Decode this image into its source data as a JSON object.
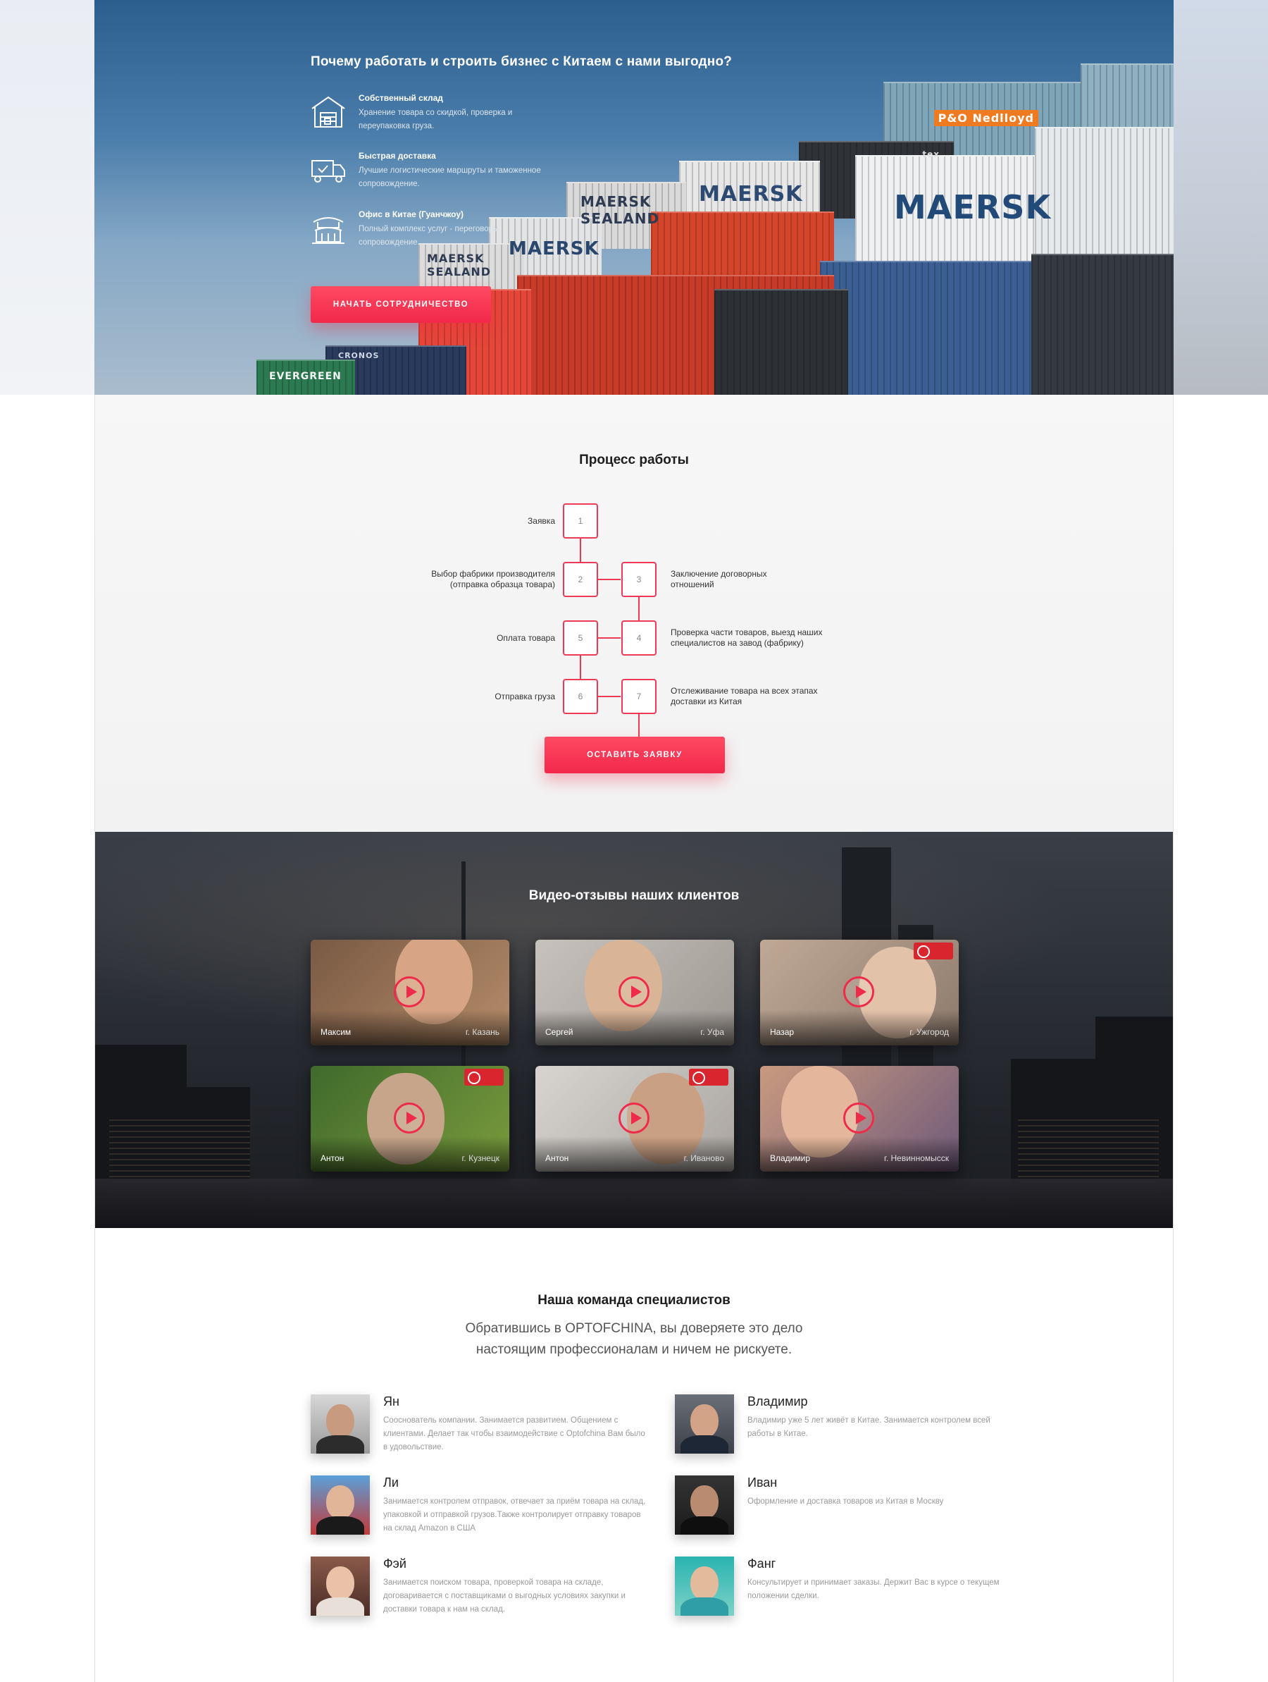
{
  "hero": {
    "title": "Почему работать и строить бизнес с Китаем с нами выгодно?",
    "features": [
      {
        "icon": "warehouse-icon",
        "title": "Собственный склад",
        "text": "Хранение товара со скидкой, проверка и переупаковка груза."
      },
      {
        "icon": "delivery-truck-icon",
        "title": "Быстрая доставка",
        "text": "Лучшие логистические маршруты и таможенное сопровождение."
      },
      {
        "icon": "china-office-icon",
        "title": "Офис в Китае (Гуанчжоу)",
        "text": "Полный комплекс услуг - переговоры, сопровождение."
      }
    ],
    "cta": "НАЧАТЬ СОТРУДНИЧЕСТВО",
    "container_labels": [
      "MAERSK",
      "MAERSK",
      "MAERSK",
      "MAERSK SEALAND",
      "MAERSK SEALAND",
      "EVERGREEN",
      "CRONOS",
      "P&O Nedlloyd",
      "tex"
    ]
  },
  "process": {
    "title": "Процесс работы",
    "steps": [
      {
        "num": "1",
        "label": "Заявка"
      },
      {
        "num": "2",
        "label": "Выбор фабрики производителя (отправка образца товара)"
      },
      {
        "num": "3",
        "label": "Заключение договорных отношений"
      },
      {
        "num": "4",
        "label": "Проверка части товаров, выезд наших специалистов на завод (фабрику)"
      },
      {
        "num": "5",
        "label": "Оплата товара"
      },
      {
        "num": "6",
        "label": "Отправка груза"
      },
      {
        "num": "7",
        "label": "Отслеживание товара на всех этапах доставки из Китая"
      }
    ],
    "cta": "ОСТАВИТЬ ЗАЯВКУ"
  },
  "video": {
    "title": "Видео-отзывы наших клиентов",
    "reviews": [
      {
        "name": "Максим",
        "city": "г. Казань"
      },
      {
        "name": "Сергей",
        "city": "г. Уфа"
      },
      {
        "name": "Назар",
        "city": "г. Ужгород"
      },
      {
        "name": "Антон",
        "city": "г. Кузнецк"
      },
      {
        "name": "Антон",
        "city": "г. Иваново"
      },
      {
        "name": "Владимир",
        "city": "г. Невинномысск"
      }
    ]
  },
  "team": {
    "title": "Наша команда специалистов",
    "subtitle_line1": "Обратившись в OPTOFCHINA, вы доверяете это дело",
    "subtitle_line2": "настоящим профессионалам и ничем не рискуете.",
    "members": [
      {
        "name": "Ян",
        "text": "Сооснователь компании. Занимается развитием. Общением с клиентами. Делает так чтобы взаимодействие с Optofchina Вам было в удовольствие."
      },
      {
        "name": "Владимир",
        "text": "Владимир уже 5 лет живёт в Китае. Занимается контролем  всей работы в Китае."
      },
      {
        "name": "Ли",
        "text": "Занимается контролем отправок, отвечает за приём товара на склад, упаковкой и отправкой грузов.Также контролирует отправку товаров на склад Amazon в США"
      },
      {
        "name": "Иван",
        "text": "Оформление и доставка товаров из Китая в Москву"
      },
      {
        "name": "Фэй",
        "text": "Занимается поиском товара, проверкой товара на складе, договаривается с поставщиками  о выгодных условиях закупки и доставки товара к нам на склад."
      },
      {
        "name": "Фанг",
        "text": "Консультирует и принимает заказы. Держит Вас в курсе о текущем  положении сделки."
      }
    ]
  },
  "colors": {
    "accent": "#f2284a",
    "accent_light": "#ff4a63",
    "step_border": "#ee3a56"
  }
}
